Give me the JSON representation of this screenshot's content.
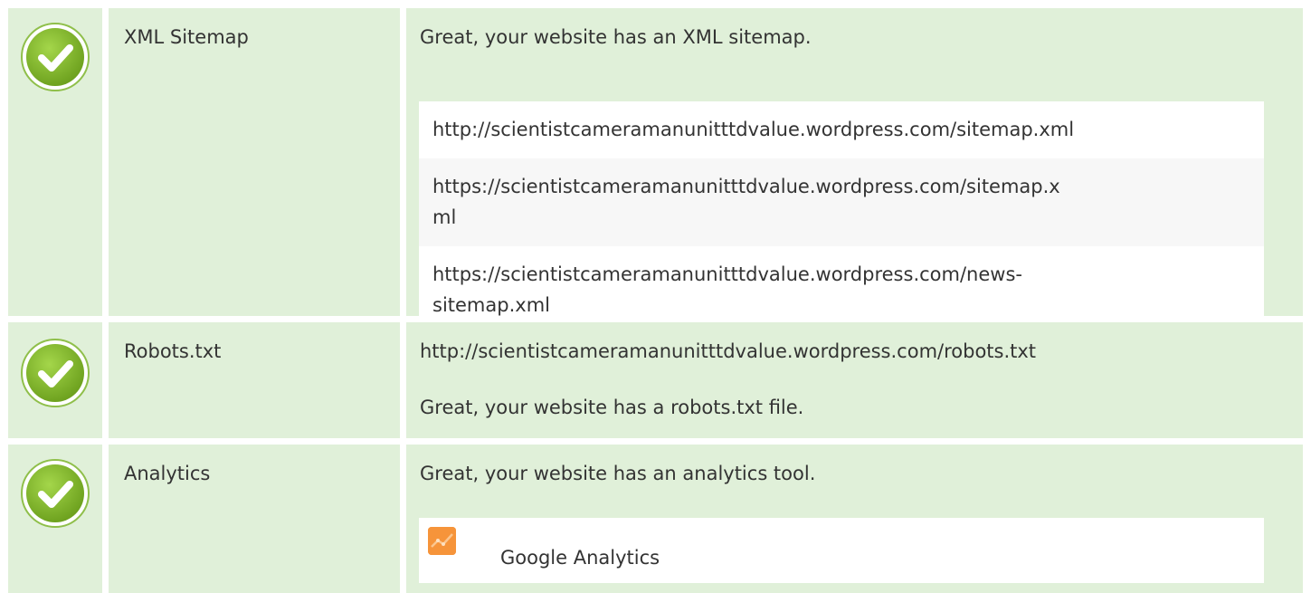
{
  "colors": {
    "row_bg": "#e0f0d9",
    "check_green": "#7fb52a",
    "analytics_orange": "#f6943a"
  },
  "rows": [
    {
      "icon": "check-circle-icon",
      "label": "XML Sitemap",
      "message": "Great, your website has an XML sitemap.",
      "urls": [
        "http://scientistcameramanunitttdvalue.wordpress.com/sitemap.xml",
        "https://scientistcameramanunitttdvalue.wordpress.com/sitemap.x\nml",
        "https://scientistcameramanunitttdvalue.wordpress.com/news-\nsitemap.xml"
      ]
    },
    {
      "icon": "check-circle-icon",
      "label": "Robots.txt",
      "url": "http://scientistcameramanunitttdvalue.wordpress.com/robots.txt",
      "message": "Great, your website has a robots.txt file."
    },
    {
      "icon": "check-circle-icon",
      "label": "Analytics",
      "message": "Great, your website has an analytics tool.",
      "tool": {
        "icon": "google-analytics-icon",
        "name": "Google Analytics"
      }
    }
  ]
}
